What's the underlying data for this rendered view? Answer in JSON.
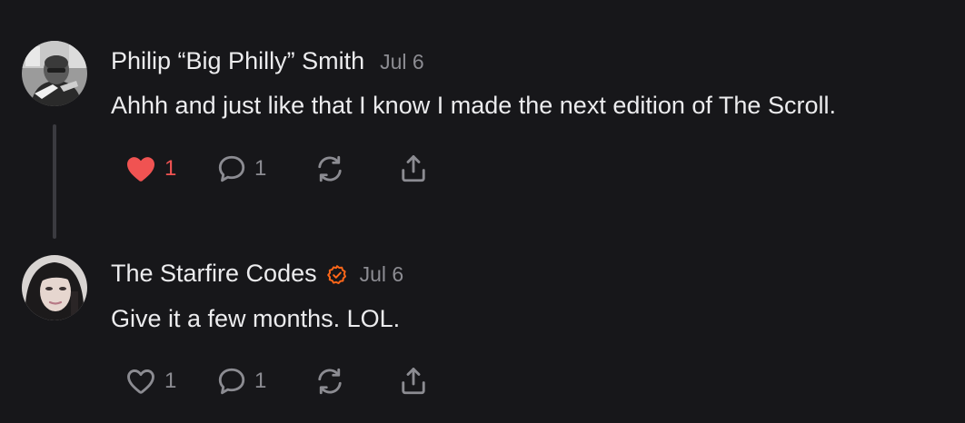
{
  "comments": [
    {
      "author": "Philip “Big Philly” Smith",
      "date": "Jul 6",
      "text": "Ahhh and just like that I know I made the next edition of The Scroll.",
      "verified": false,
      "liked": true,
      "like_count": "1",
      "reply_count": "1",
      "avatar_icon": "user-avatar-photo"
    },
    {
      "author": "The Starfire Codes",
      "date": "Jul 6",
      "text": "Give it a few months. LOL.",
      "verified": true,
      "liked": false,
      "like_count": "1",
      "reply_count": "1",
      "avatar_icon": "user-avatar-photo"
    }
  ],
  "icons": {
    "like": "heart-icon",
    "reply": "comment-bubble-icon",
    "restack": "restack-icon",
    "share": "share-icon",
    "verified": "verified-badge-icon"
  },
  "colors": {
    "background": "#17171a",
    "text": "#ececee",
    "muted": "#8c8c92",
    "like_active": "#f05352",
    "verified_badge": "#ff6719",
    "thread_line": "#3b3b40"
  }
}
